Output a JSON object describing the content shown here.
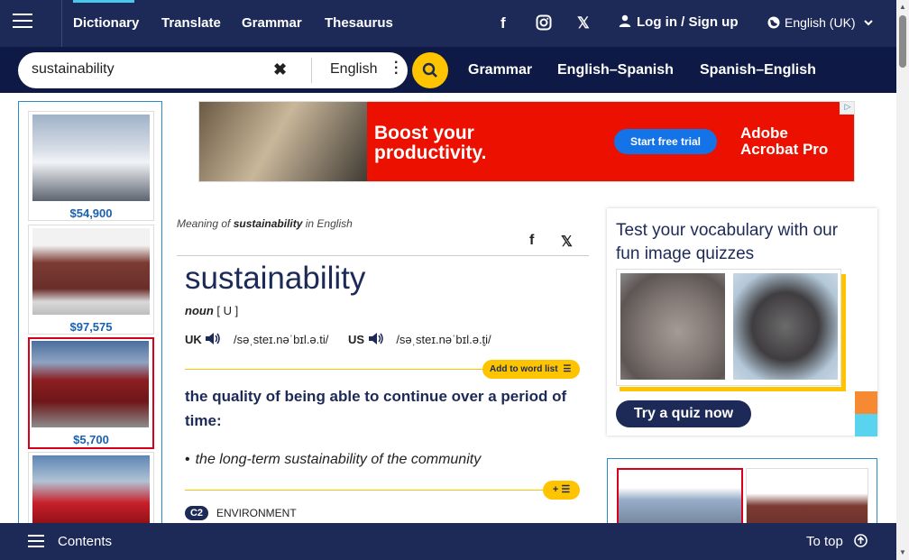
{
  "nav": {
    "links": [
      "Dictionary",
      "Translate",
      "Grammar",
      "Thesaurus"
    ],
    "login": "Log in / Sign up",
    "language": "English (UK)"
  },
  "search": {
    "value": "sustainability",
    "language": "English",
    "links": [
      "Grammar",
      "English–Spanish",
      "Spanish–English"
    ]
  },
  "left_ads": [
    {
      "price": "$54,900"
    },
    {
      "price": "$97,575"
    },
    {
      "price": "$5,700"
    }
  ],
  "banner": {
    "headline": "Boost your productivity.",
    "cta": "Start free trial",
    "brand": "Adobe Acrobat Pro"
  },
  "entry": {
    "meaning_prefix": "Meaning of",
    "meaning_word": "sustainability",
    "meaning_suffix": "in English",
    "headword": "sustainability",
    "pos": "noun",
    "grammar": "[ U ]",
    "uk_label": "UK",
    "uk_ipa": "/səˌsteɪ.nəˈbɪl.ə.ti/",
    "us_label": "US",
    "us_ipa": "/səˌsteɪ.nəˈbɪl.ə.t̬i/",
    "wordlist_label": "Add to word list",
    "definition": "the quality of being able to continue over a period of time:",
    "example": "the long-term sustainability of the community",
    "level": "C2",
    "topic": "ENVIRONMENT"
  },
  "quiz": {
    "title": "Test your vocabulary with our fun image quizzes",
    "button": "Try a quiz now"
  },
  "bottom": {
    "contents": "Contents",
    "totop": "To top"
  }
}
